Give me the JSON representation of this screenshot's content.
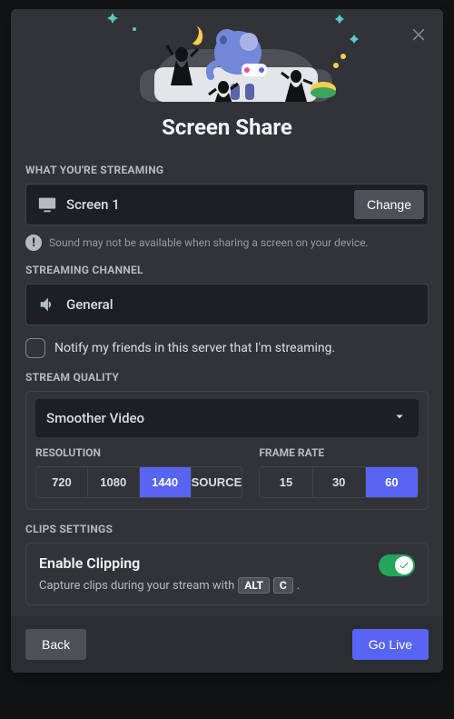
{
  "title": "Screen Share",
  "sections": {
    "streaming_label": "WHAT YOU'RE STREAMING",
    "source_name": "Screen 1",
    "change_label": "Change",
    "sound_hint": "Sound may not be available when sharing a screen on your device.",
    "channel_label": "STREAMING CHANNEL",
    "channel_name": "General",
    "notify_label": "Notify my friends in this server that I'm streaming.",
    "quality_label": "STREAM QUALITY",
    "preset_label": "Smoother Video",
    "resolution_label": "RESOLUTION",
    "framerate_label": "FRAME RATE",
    "clips_label": "CLIPS SETTINGS",
    "clips_title": "Enable Clipping",
    "clips_desc_prefix": "Capture clips during your stream with",
    "clips_key1": "ALT",
    "clips_key2": "C",
    "clips_desc_suffix": "."
  },
  "resolution": {
    "options": [
      "720",
      "1080",
      "1440",
      "SOURCE"
    ],
    "selected": "1440",
    "o0": "720",
    "o1": "1080",
    "o2": "1440",
    "o3": "SOURCE"
  },
  "framerate": {
    "options": [
      "15",
      "30",
      "60"
    ],
    "selected": "60",
    "o0": "15",
    "o1": "30",
    "o2": "60"
  },
  "footer": {
    "back": "Back",
    "go_live": "Go Live"
  },
  "colors": {
    "accent": "#5865f2",
    "success": "#23a55a"
  }
}
